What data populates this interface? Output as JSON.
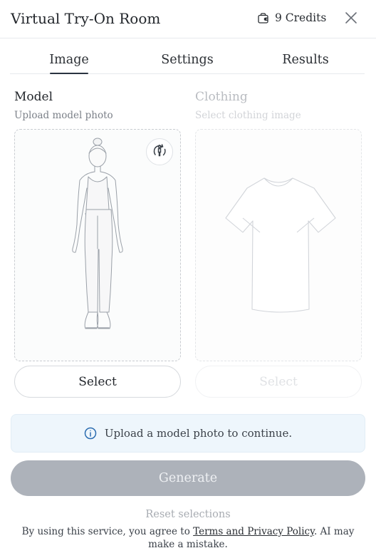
{
  "header": {
    "title": "Virtual Try-On Room",
    "credits": "9 Credits",
    "credits_icon": "wallet-bag-icon",
    "close_icon": "close-icon"
  },
  "tabs": [
    {
      "label": "Image",
      "active": true
    },
    {
      "label": "Settings",
      "active": false
    },
    {
      "label": "Results",
      "active": false
    }
  ],
  "model": {
    "label": "Model",
    "subtitle": "Upload model photo",
    "select_label": "Select",
    "swap_icon": "person-rotate-icon"
  },
  "clothing": {
    "label": "Clothing",
    "subtitle": "Select clothing image",
    "select_label": "Select"
  },
  "info": {
    "icon": "info-icon",
    "text": "Upload a model photo to continue."
  },
  "actions": {
    "generate_label": "Generate",
    "reset_label": "Reset selections"
  },
  "terms": {
    "prefix": "By using this service, you agree to ",
    "link": "Terms and Privacy Policy",
    "suffix": ". AI may make a mistake."
  },
  "colors": {
    "accent": "#2a3340",
    "info_bg": "#eef6fc",
    "info_icon": "#2b6cb0",
    "generate_disabled": "#adb2ba"
  }
}
